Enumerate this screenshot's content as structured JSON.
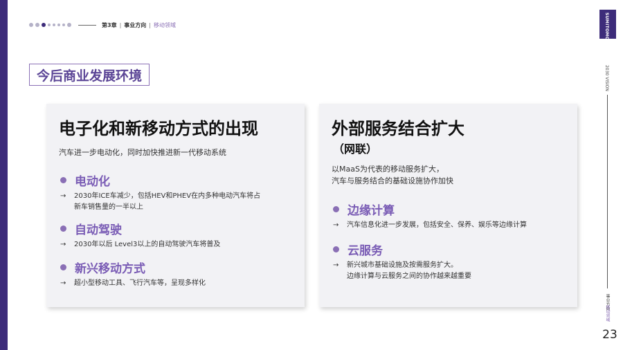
{
  "header": {
    "chapter": "第3章",
    "section": "事业方向",
    "subsection": "移动领域"
  },
  "rail": {
    "brand": "SUMITOMO ELECTRIC",
    "vision": "2030 VISION",
    "section": "事业方向",
    "subsection": "移动领域"
  },
  "page_number": "23",
  "section_title": "今后商业发展环境",
  "left_card": {
    "title": "电子化和新移动方式的出现",
    "subtitle": "汽车进一步电动化，同时加快推进新一代移动系统",
    "items": [
      {
        "label": "电动化",
        "arrow": "→",
        "text": "2030年ICE车减少，包括HEV和PHEV在内多种电动汽车将占\n新车销售量的一半以上"
      },
      {
        "label": "自动驾驶",
        "arrow": "→",
        "text": "2030年以后 Level3以上的自动驾驶汽车将普及"
      },
      {
        "label": "新兴移动方式",
        "arrow": "→",
        "text": "超小型移动工具、飞行汽车等，呈现多样化"
      }
    ]
  },
  "right_card": {
    "title": "外部服务结合扩大",
    "title_sub": "（网联）",
    "subtitle_line1": "以MaaS为代表的移动服务扩大，",
    "subtitle_line2": "汽车与服务结合的基础设施协作加快",
    "items": [
      {
        "label": "边缘计算",
        "arrow": "→",
        "text": "汽车信息化进一步发展，包括安全、保养、娱乐等边缘计算"
      },
      {
        "label": "云服务",
        "arrow": "→",
        "text": "新兴城市基础设施及按需服务扩大。\n边缘计算与云服务之间的协作越来越重要"
      }
    ]
  },
  "colors": {
    "brand_purple": "#3d2c7a",
    "accent_purple": "#8a6fb5",
    "card_bg": "#f2f2f5"
  }
}
